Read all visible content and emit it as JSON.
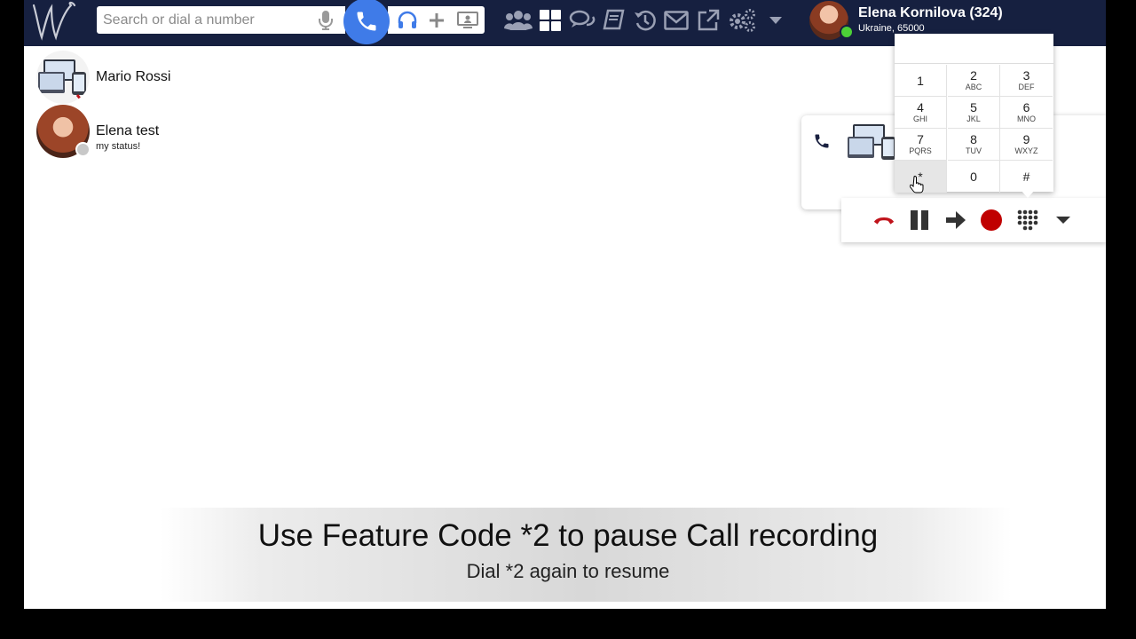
{
  "search": {
    "placeholder": "Search or dial a number"
  },
  "icons": {
    "logo": "w-logo",
    "mic": "microphone-icon",
    "call": "phone-icon",
    "headset": "headset-icon",
    "add": "plus-icon",
    "screen": "screen-share-icon",
    "groups": "users-icon",
    "apps": "grid-icon",
    "chat": "chat-icon",
    "phonebook": "book-icon",
    "history": "history-icon",
    "mail": "mail-icon",
    "external": "external-link-icon",
    "settings": "gear-icon",
    "menu": "chevron-down-icon"
  },
  "user": {
    "name": "Elena Kornilova (324)",
    "location": "Ukraine, 65000",
    "presence_color": "#4cd137"
  },
  "contacts": [
    {
      "name": "Mario Rossi",
      "status": "",
      "avatar": "device-avatar"
    },
    {
      "name": "Elena test",
      "status": "my status!",
      "avatar": "photo-avatar"
    }
  ],
  "dialpad": {
    "keys": [
      {
        "digit": "1",
        "letters": ""
      },
      {
        "digit": "2",
        "letters": "ABC"
      },
      {
        "digit": "3",
        "letters": "DEF"
      },
      {
        "digit": "4",
        "letters": "GHI"
      },
      {
        "digit": "5",
        "letters": "JKL"
      },
      {
        "digit": "6",
        "letters": "MNO"
      },
      {
        "digit": "7",
        "letters": "PQRS"
      },
      {
        "digit": "8",
        "letters": "TUV"
      },
      {
        "digit": "9",
        "letters": "WXYZ"
      },
      {
        "digit": "*",
        "letters": ""
      },
      {
        "digit": "0",
        "letters": ""
      },
      {
        "digit": "#",
        "letters": ""
      }
    ],
    "hovered_key": "*"
  },
  "call_controls": [
    "hangup-icon",
    "pause-icon",
    "transfer-icon",
    "record-icon",
    "dialpad-icon",
    "chevron-down-icon"
  ],
  "colors": {
    "topbar": "#162040",
    "call_button": "#3f7be8",
    "hangup": "#c0131b",
    "record": "#c00000"
  },
  "caption": {
    "title": "Use Feature Code *2 to pause Call recording",
    "subtitle": "Dial *2 again to resume"
  }
}
